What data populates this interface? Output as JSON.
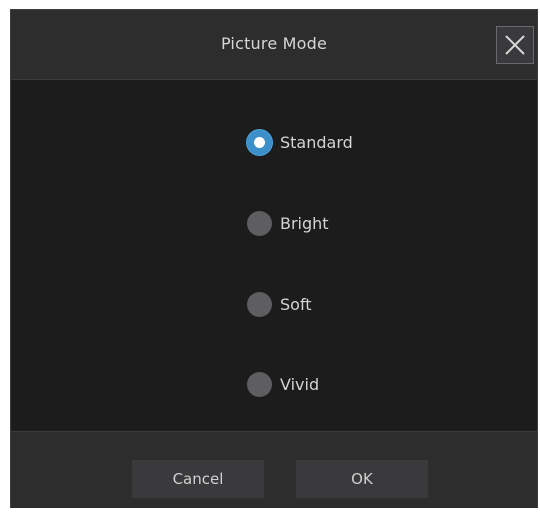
{
  "dialog": {
    "title": "Picture Mode",
    "close_icon": "close-icon",
    "options": [
      {
        "label": "Standard",
        "checked": true
      },
      {
        "label": "Bright",
        "checked": false
      },
      {
        "label": "Soft",
        "checked": false
      },
      {
        "label": "Vivid",
        "checked": false
      }
    ],
    "cancel_label": "Cancel",
    "ok_label": "OK"
  },
  "colors": {
    "background": "#1c1c1d",
    "header_footer": "#2d2d2e",
    "accent": "#3d8fc9",
    "radio_unchecked": "#5e5e60",
    "button": "#3a3a3c",
    "text": "#d6d6d6"
  }
}
